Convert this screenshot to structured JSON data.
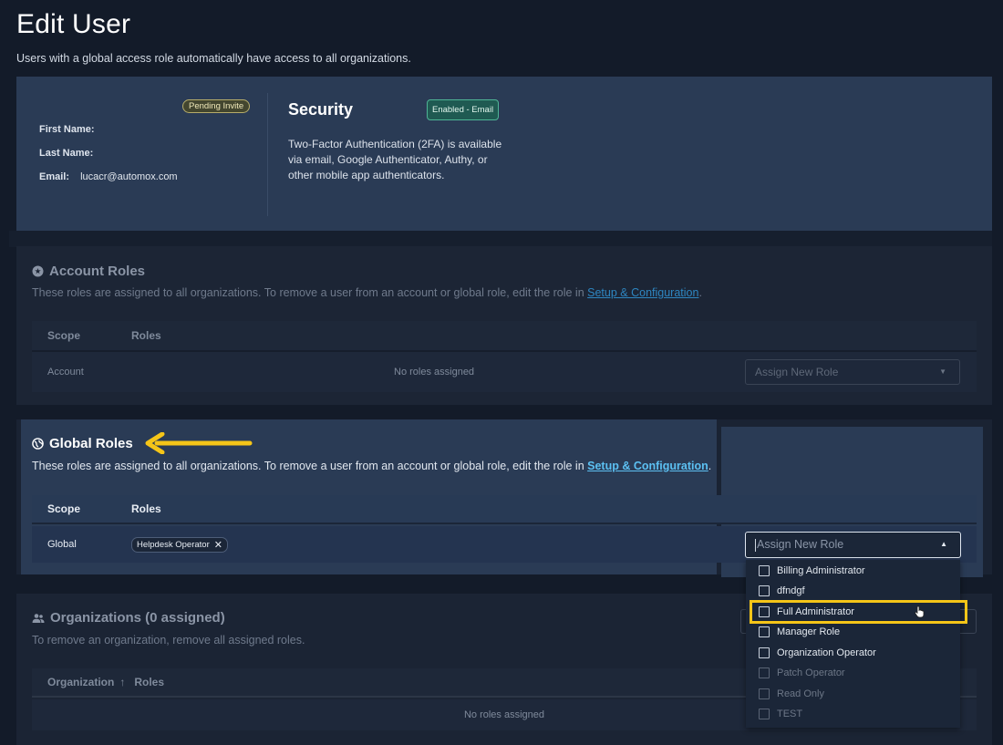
{
  "header": {
    "title": "Edit User",
    "subtitle": "Users with a global access role automatically have access to all organizations."
  },
  "user_card": {
    "status_badge": "Pending Invite",
    "first_name_label": "First Name:",
    "first_name_value": "",
    "last_name_label": "Last Name:",
    "last_name_value": "",
    "email_label": "Email:",
    "email_value": "lucacr@automox.com"
  },
  "security": {
    "title": "Security",
    "badge": "Enabled - Email",
    "description": "Two-Factor Authentication (2FA) is available via email, Google Authenticator, Authy, or other mobile app authenticators."
  },
  "account_roles": {
    "title": "Account Roles",
    "description_prefix": "These roles are assigned to all organizations. To remove a user from an account or global role, edit the role in ",
    "link": "Setup & Configuration",
    "suffix": ".",
    "columns": [
      "Scope",
      "Roles"
    ],
    "row_scope": "Account",
    "row_roles": "No roles assigned",
    "select_placeholder": "Assign New Role"
  },
  "global_roles": {
    "title": "Global Roles",
    "description_prefix": "These roles are assigned to all organizations. To remove a user from an account or global role, edit the role in ",
    "link": "Setup & Configuration",
    "suffix": ".",
    "columns": [
      "Scope",
      "Roles"
    ],
    "row_scope": "Global",
    "chip": "Helpdesk Operator",
    "select_placeholder": "Assign New Role",
    "options": [
      {
        "label": "Billing Administrator",
        "enabled": true
      },
      {
        "label": "dfndgf",
        "enabled": true
      },
      {
        "label": "Full Administrator",
        "enabled": true
      },
      {
        "label": "Manager Role",
        "enabled": true
      },
      {
        "label": "Organization Operator",
        "enabled": true
      },
      {
        "label": "Patch Operator",
        "enabled": false
      },
      {
        "label": "Read Only",
        "enabled": false
      },
      {
        "label": "TEST",
        "enabled": false
      }
    ]
  },
  "organizations": {
    "title": "Organizations (0 assigned)",
    "description": "To remove an organization, remove all assigned roles.",
    "columns": [
      "Organization",
      "Roles"
    ],
    "sort_icon": "arrow-up-icon",
    "empty": "No roles assigned"
  },
  "colors": {
    "highlight": "#f5c518",
    "link": "#5cc0f2",
    "card": "#2a3b55"
  }
}
